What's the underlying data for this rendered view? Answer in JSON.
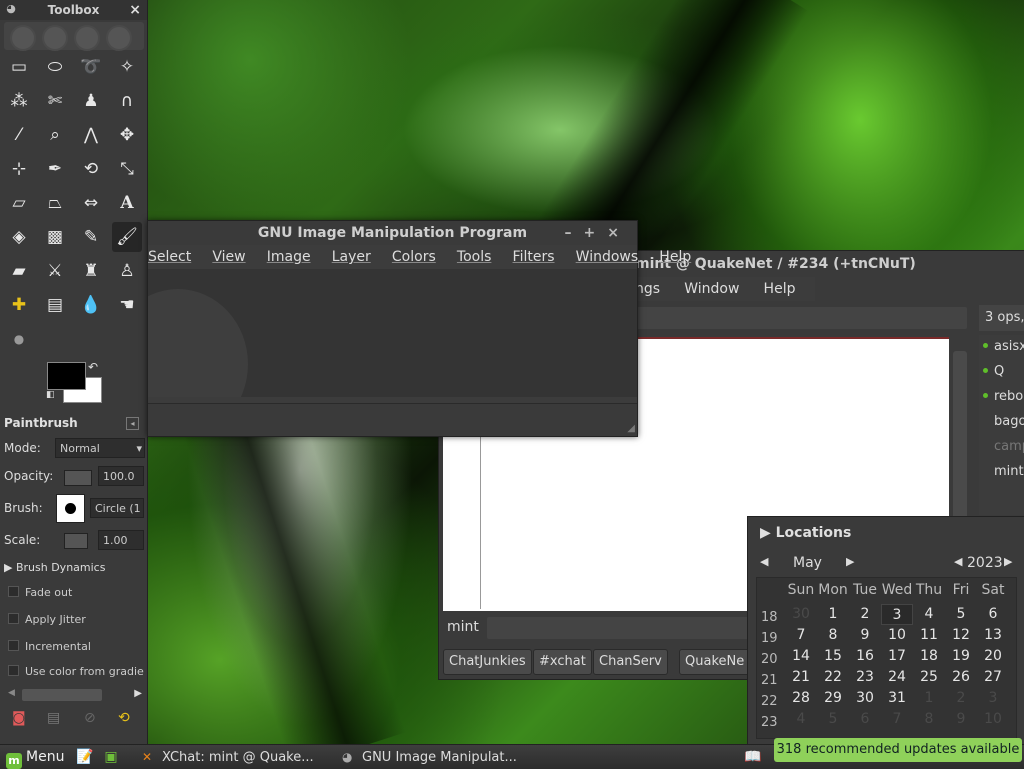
{
  "toolbox": {
    "title": "Toolbox",
    "close": "×",
    "options_title": "Paintbrush",
    "mode_label": "Mode:",
    "mode_value": "Normal",
    "opacity_label": "Opacity:",
    "opacity_value": "100.0",
    "brush_label": "Brush:",
    "brush_value": "Circle (1",
    "scale_label": "Scale:",
    "scale_value": "1.00",
    "brush_dynamics": "Brush Dynamics",
    "checks": [
      "Fade out",
      "Apply Jitter",
      "Incremental",
      "Use color from gradie"
    ]
  },
  "gimp": {
    "title": "GNU Image Manipulation Program",
    "menu": [
      "Select",
      "View",
      "Image",
      "Layer",
      "Colors",
      "Tools",
      "Filters",
      "Windows",
      "Help"
    ]
  },
  "xchat": {
    "title": "mint @ QuakeNet / #234 (+tnCNuT)",
    "menu": [
      "ngs",
      "Window",
      "Help"
    ],
    "users_count": "3 ops,",
    "users": [
      {
        "name": "asisx",
        "op": true
      },
      {
        "name": "Q",
        "op": true
      },
      {
        "name": "rebo",
        "op": true
      },
      {
        "name": "bago",
        "op": false
      },
      {
        "name": "camp",
        "op": false
      },
      {
        "name": "mint",
        "op": false
      }
    ],
    "nick": "mint",
    "tabs": [
      "ChatJunkies",
      "#xchat",
      "ChanServ",
      "QuakeNe"
    ]
  },
  "calendar": {
    "locations": "Locations",
    "month": "May",
    "year": "2023",
    "headers": [
      "Sun",
      "Mon",
      "Tue",
      "Wed",
      "Thu",
      "Fri",
      "Sat"
    ],
    "weeks": [
      "18",
      "19",
      "20",
      "21",
      "22",
      "23"
    ],
    "rows": [
      [
        "30",
        "1",
        "2",
        "3",
        "4",
        "5",
        "6"
      ],
      [
        "7",
        "8",
        "9",
        "10",
        "11",
        "12",
        "13"
      ],
      [
        "14",
        "15",
        "16",
        "17",
        "18",
        "19",
        "20"
      ],
      [
        "21",
        "22",
        "23",
        "24",
        "25",
        "26",
        "27"
      ],
      [
        "28",
        "29",
        "30",
        "31",
        "1",
        "2",
        "3"
      ],
      [
        "4",
        "5",
        "6",
        "7",
        "8",
        "9",
        "10"
      ]
    ]
  },
  "panel": {
    "menu_label": "Menu",
    "tasks": [
      "XChat: mint @ Quake...",
      "GNU Image Manipulat..."
    ]
  },
  "notification": "318 recommended updates available"
}
